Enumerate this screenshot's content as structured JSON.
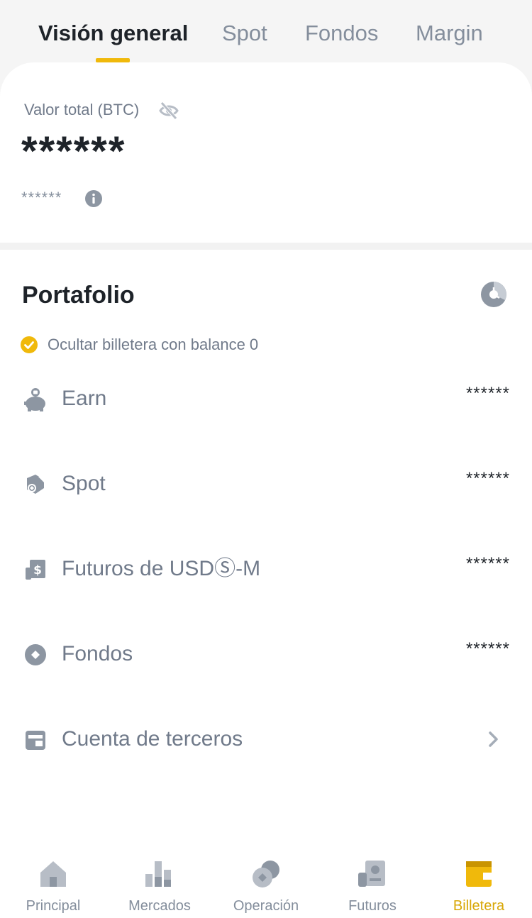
{
  "tabs": [
    {
      "label": "Visión general",
      "active": true
    },
    {
      "label": "Spot",
      "active": false
    },
    {
      "label": "Fondos",
      "active": false
    },
    {
      "label": "Margin",
      "active": false
    }
  ],
  "overview": {
    "total_label": "Valor total (BTC)",
    "total_value": "******",
    "sub_value": "******",
    "eye_icon": "eye-off-icon",
    "info_icon": "info-icon"
  },
  "portfolio": {
    "title": "Portafolio",
    "chart_icon": "pie-chart-icon",
    "hide_zero_label": "Ocultar billetera con balance 0",
    "hide_zero_checked": true,
    "wallets": [
      {
        "label": "Earn",
        "value": "******",
        "icon": "piggy-bank-icon"
      },
      {
        "label": "Spot",
        "value": "******",
        "icon": "spot-icon"
      },
      {
        "label": "Futuros de USDⓈ-M",
        "value": "******",
        "icon": "usd-futures-icon"
      },
      {
        "label": "Fondos",
        "value": "******",
        "icon": "funding-icon"
      },
      {
        "label": "Cuenta de terceros",
        "value": "",
        "icon": "third-party-account-icon"
      }
    ]
  },
  "bottom_nav": [
    {
      "label": "Principal",
      "icon": "home-icon",
      "active": false
    },
    {
      "label": "Mercados",
      "icon": "markets-icon",
      "active": false
    },
    {
      "label": "Operación",
      "icon": "trade-icon",
      "active": false
    },
    {
      "label": "Futuros",
      "icon": "futures-icon",
      "active": false
    },
    {
      "label": "Billetera",
      "icon": "wallet-icon",
      "active": true
    }
  ],
  "colors": {
    "accent": "#f0b90b",
    "accent_text": "#d8a706",
    "text_primary": "#1e2329",
    "text_secondary": "#707a8a",
    "text_muted": "#848e9c",
    "icon_gray": "#a5adb8"
  }
}
